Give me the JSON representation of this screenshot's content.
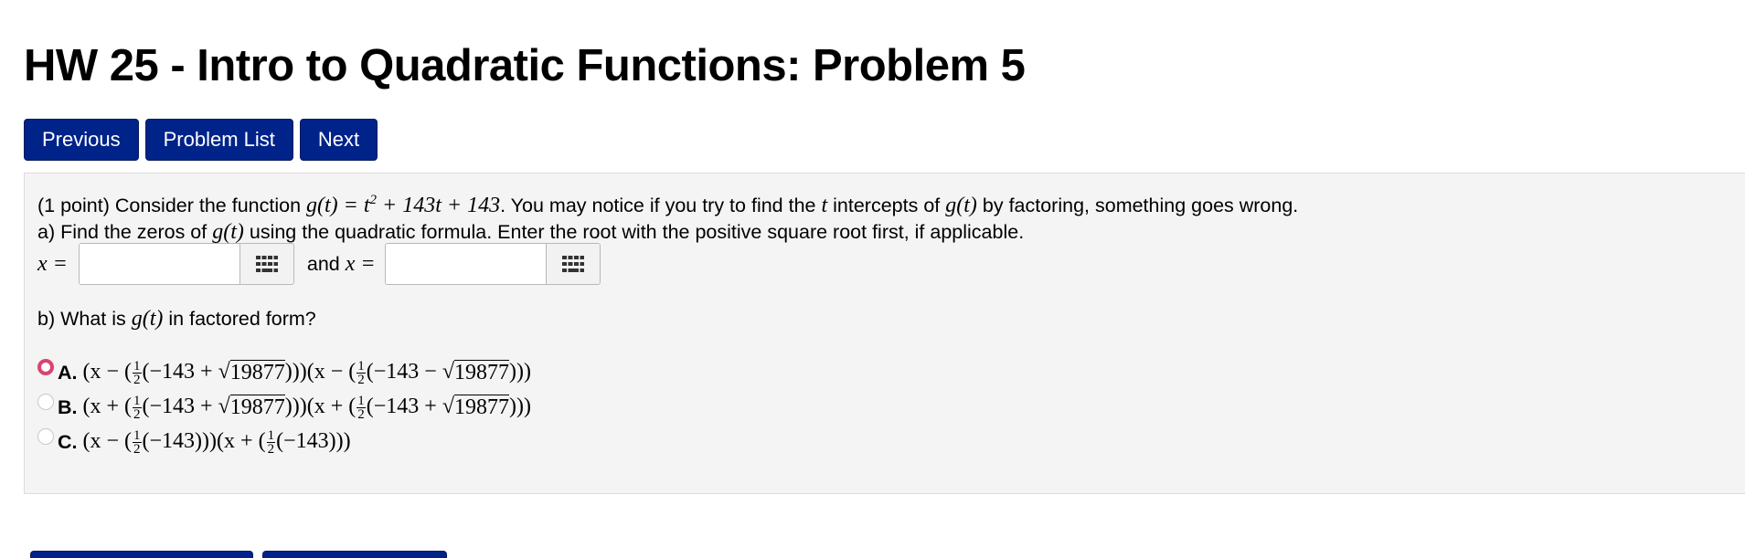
{
  "page": {
    "title": "HW 25 - Intro to Quadratic Functions: Problem 5"
  },
  "nav": {
    "previous": "Previous",
    "problem_list": "Problem List",
    "next": "Next"
  },
  "problem": {
    "points": "(1 point) Consider the function",
    "func_name": "g(t) = t",
    "func_exp": "2",
    "func_rest": " + 143t + 143",
    "intro_rest": ". You may notice if you try to find the",
    "var_t": "t",
    "intro_rest2": "intercepts of",
    "g_of_t": "g(t)",
    "intro_rest3": "by factoring, something goes wrong.",
    "part_a_1": "a) Find the zeros of",
    "part_a_2": "using the quadratic formula. Enter the root with the positive square root first, if applicable.",
    "x_eq": "x =",
    "and_text": "and",
    "answer1": "",
    "answer2": "",
    "part_b_1": "b) What is",
    "part_b_2": "in factored form?",
    "choices": [
      {
        "label": "A.",
        "selected": true,
        "p1": "(x − (",
        "p2": "(−143 + ",
        "rad": "19877",
        "p3": ")))(x − (",
        "p4": "(−143 − ",
        "rad2": "19877",
        "p5": ")))"
      },
      {
        "label": "B.",
        "selected": false,
        "p1": "(x + (",
        "p2": "(−143 + ",
        "rad": "19877",
        "p3": ")))(x + (",
        "p4": "(−143 + ",
        "rad2": "19877",
        "p5": ")))"
      },
      {
        "label": "C.",
        "selected": false,
        "p1": "(x − (",
        "p2": "(−143)))(x + (",
        "p3": "(−143)))"
      }
    ],
    "frac_num": "1",
    "frac_den": "2"
  },
  "colors": {
    "button_bg": "#00238a",
    "panel_bg": "#f4f4f4",
    "radio_selected": "#d9456f"
  },
  "icons": {
    "keypad": "keypad-grid-icon",
    "radio": "radio-button-icon"
  }
}
